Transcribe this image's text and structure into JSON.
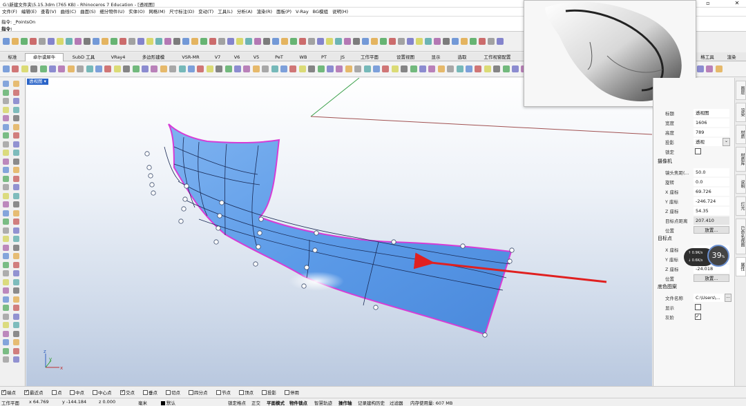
{
  "window": {
    "title": "G:\\新建文件夹\\5.15.3dm (765 KB) - Rhinoceros 7 Education - [透视图]"
  },
  "menu": [
    "文件(F)",
    "编辑(E)",
    "查看(V)",
    "曲线(C)",
    "曲面(S)",
    "细分物件(U)",
    "实体(O)",
    "网格(M)",
    "尺寸标注(D)",
    "变动(T)",
    "工具(L)",
    "分析(A)",
    "渲染(R)",
    "面板(P)",
    "V-Ray",
    "BG模组",
    "说明(H)"
  ],
  "command": {
    "history": "指令: _PointsOn",
    "prompt": "指令:"
  },
  "tabs": [
    "标准",
    "卓尔谟犀牛",
    "SubD 工具",
    "VRay4",
    "多边形建模",
    "VSR-MR",
    "V7",
    "V6",
    "V5",
    "PeT",
    "WB",
    "PT",
    "JS",
    "工作平面",
    "设置视图",
    "显示",
    "选取",
    "工作视窗配置",
    "格工具",
    "渲染"
  ],
  "viewport": {
    "label": "透视图",
    "axis": {
      "x": "x",
      "y": "y",
      "z": "z"
    }
  },
  "properties": {
    "viewport_rows": [
      {
        "label": "标题",
        "value": "透视图"
      },
      {
        "label": "宽度",
        "value": "1606"
      },
      {
        "label": "高度",
        "value": "789"
      },
      {
        "label": "投影",
        "value": "透视"
      },
      {
        "label": "锁定",
        "value": ""
      }
    ],
    "camera_head": "摄像机",
    "camera_rows": [
      {
        "label": "镜头焦距(...",
        "value": "50.0"
      },
      {
        "label": "旋转",
        "value": "0.0"
      },
      {
        "label": "X 座标",
        "value": "69.726"
      },
      {
        "label": "Y 座标",
        "value": "-246.724"
      },
      {
        "label": "Z 座标",
        "value": "54.35"
      },
      {
        "label": "目标点距离",
        "value": "207.410"
      },
      {
        "label": "位置",
        "value": "放置..."
      }
    ],
    "target_head": "目标点",
    "target_rows": [
      {
        "label": "X 座标",
        "value": ""
      },
      {
        "label": "Y 座标",
        "value": ""
      },
      {
        "label": "Z 座标",
        "value": "-24.018"
      },
      {
        "label": "位置",
        "value": "放置..."
      }
    ],
    "bg_head": "底色图案",
    "bg_rows": [
      {
        "label": "文件名称",
        "value": "C:\\Users\\..."
      },
      {
        "label": "显示",
        "value": ""
      },
      {
        "label": "灰阶",
        "value": ""
      }
    ]
  },
  "gauge": {
    "percent": "39",
    "unit": "%",
    "up": "0.9",
    "down": "0.6",
    "rate_unit": "K/s"
  },
  "right_tabs": [
    "图层",
    "渲染",
    "材质",
    "材质库",
    "说明",
    "灯光",
    "已命名视图",
    "属性"
  ],
  "osnaps": [
    {
      "label": "端点",
      "checked": true
    },
    {
      "label": "最近点",
      "checked": true
    },
    {
      "label": "点",
      "checked": false
    },
    {
      "label": "中点",
      "checked": false
    },
    {
      "label": "中心点",
      "checked": false
    },
    {
      "label": "交点",
      "checked": true
    },
    {
      "label": "垂点",
      "checked": false
    },
    {
      "label": "切点",
      "checked": false
    },
    {
      "label": "四分点",
      "checked": false
    },
    {
      "label": "节点",
      "checked": false
    },
    {
      "label": "顶点",
      "checked": false
    },
    {
      "label": "投影",
      "checked": false
    },
    {
      "label": "停用",
      "checked": false
    }
  ],
  "status": {
    "cplane": "工作平面",
    "x": "x 64.769",
    "y": "y -144.184",
    "z": "z 0.000",
    "unit": "毫米",
    "layer": "默认",
    "items": [
      "锁定格点",
      "正交",
      "平面模式",
      "物件锁点",
      "智慧轨迹",
      "操作轴",
      "记录建构历史",
      "过滤器",
      "内存使用量: 607 MB"
    ]
  },
  "colors": {
    "surface": "#5c9be8",
    "surface_edge": "#d63cd6",
    "arrow": "#e02020",
    "viewport_label": "#2a64c8"
  }
}
